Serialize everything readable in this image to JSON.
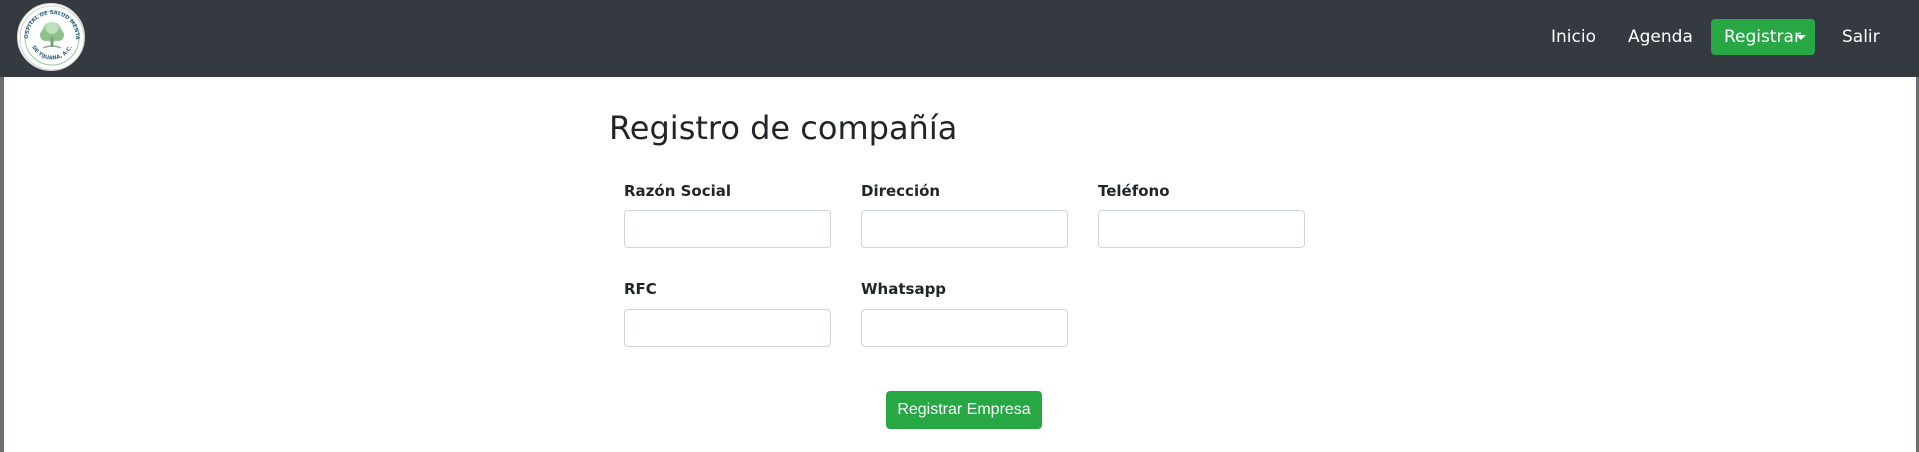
{
  "navbar": {
    "logo": {
      "icon": "hospital-seal-icon",
      "arc_top": "HOSPITAL DE SALUD MENTAL",
      "arc_bottom": "DE TIJUANA, A.C.",
      "accent_color": "#7fb77e"
    },
    "links": {
      "inicio": "Inicio",
      "agenda": "Agenda",
      "registrar": "Registrar",
      "salir": "Salir"
    },
    "background_color": "#343a40",
    "button_color": "#28a745"
  },
  "form": {
    "title": "Registro de compañía",
    "fields": {
      "razon_social": {
        "label": "Razón Social",
        "value": "",
        "placeholder": ""
      },
      "direccion": {
        "label": "Dirección",
        "value": "",
        "placeholder": ""
      },
      "telefono": {
        "label": "Teléfono",
        "value": "",
        "placeholder": ""
      },
      "rfc": {
        "label": "RFC",
        "value": "",
        "placeholder": ""
      },
      "whatsapp": {
        "label": "Whatsapp",
        "value": "",
        "placeholder": ""
      }
    },
    "submit_label": "Registrar Empresa"
  }
}
